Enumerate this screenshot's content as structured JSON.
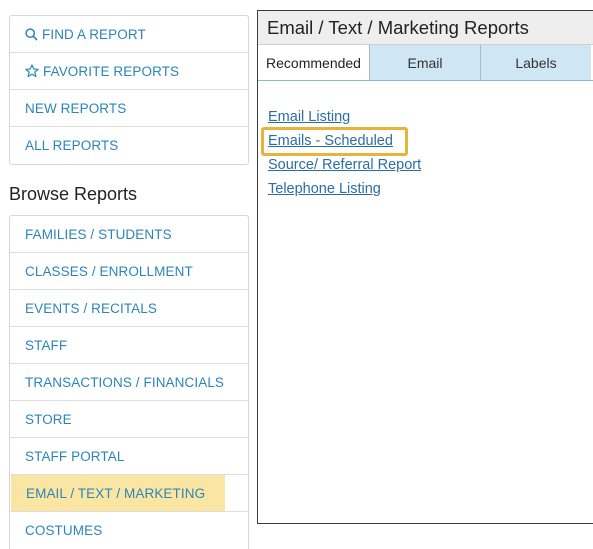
{
  "quick": {
    "find": "FIND A REPORT",
    "favorites": "FAVORITE REPORTS",
    "new": "NEW REPORTS",
    "all": "ALL REPORTS"
  },
  "browse": {
    "title": "Browse Reports",
    "items": [
      "FAMILIES / STUDENTS",
      "CLASSES / ENROLLMENT",
      "EVENTS / RECITALS",
      "STAFF",
      "TRANSACTIONS / FINANCIALS",
      "STORE",
      "STAFF PORTAL",
      "EMAIL / TEXT / MARKETING",
      "COSTUMES"
    ]
  },
  "panel": {
    "title": "Email / Text / Marketing Reports",
    "tabs": [
      "Recommended",
      "Email",
      "Labels"
    ],
    "links": [
      "Email Listing",
      "Emails - Scheduled",
      "Source/ Referral Report",
      "Telephone Listing"
    ]
  },
  "colors": {
    "link": "#2a86b8",
    "active_highlight": "#fbe5a3",
    "callout_border": "#e9b23a",
    "tab_bg": "#cfe7f5"
  }
}
